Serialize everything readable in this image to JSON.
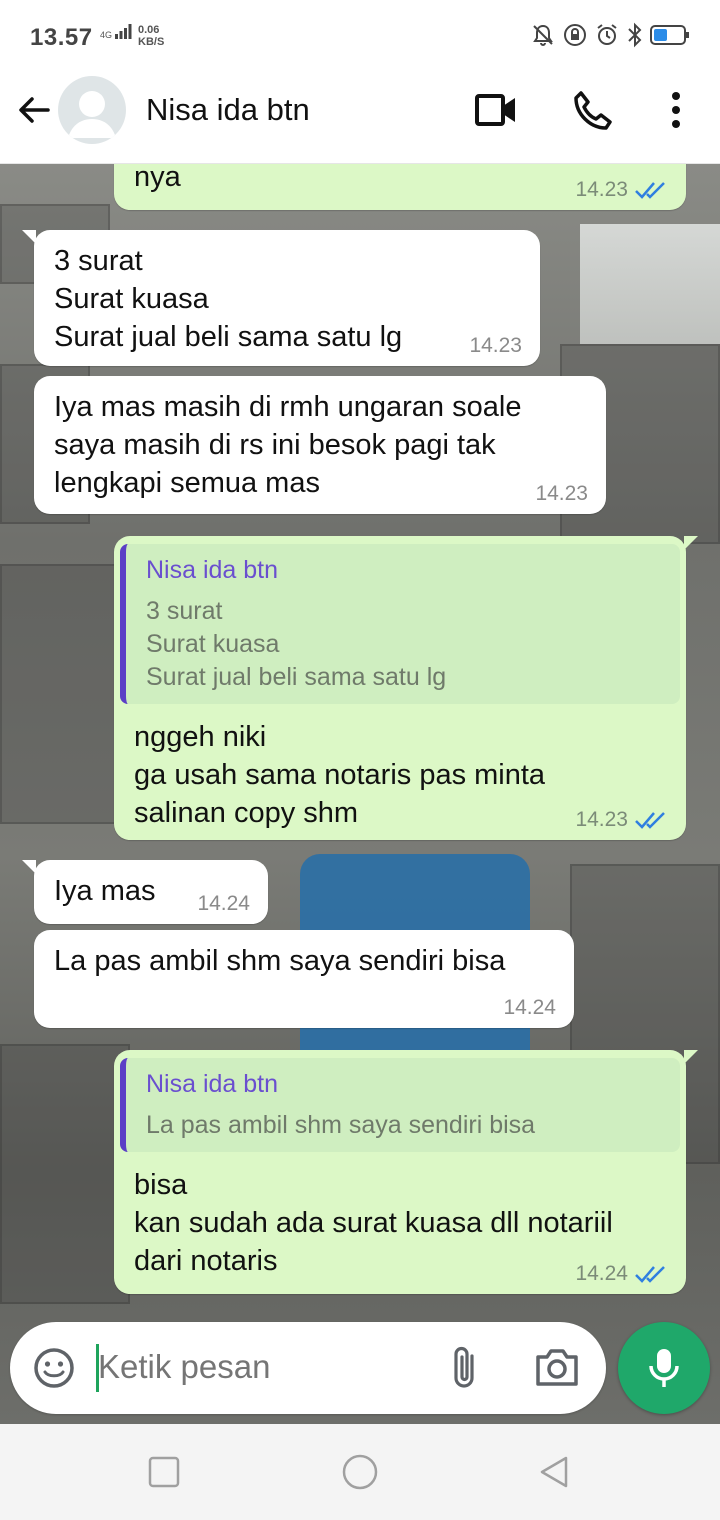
{
  "status_bar": {
    "time": "13.57",
    "network": "4G",
    "speed_value": "0.06",
    "speed_unit": "KB/S",
    "icons": [
      "bell-off-icon",
      "lock-rotation-icon",
      "alarm-icon",
      "bluetooth-icon",
      "battery-icon"
    ],
    "battery_color": "#2b8ce8"
  },
  "header": {
    "contact_name": "Nisa ida btn",
    "icons": [
      "back-arrow-icon",
      "avatar-icon",
      "video-call-icon",
      "phone-call-icon",
      "more-vert-icon"
    ]
  },
  "messages": [
    {
      "direction": "out",
      "text": "nya",
      "time": "14.23",
      "ticks": "read"
    },
    {
      "direction": "in",
      "text": "3 surat\nSurat kuasa\nSurat jual beli sama satu lg",
      "time": "14.23"
    },
    {
      "direction": "in",
      "text": "Iya mas masih di rmh ungaran soale\nsaya masih di rs ini besok pagi tak\nlengkapi semua mas",
      "time": "14.23"
    },
    {
      "direction": "out",
      "quote": {
        "name": "Nisa ida btn",
        "text": "3 surat\nSurat kuasa\nSurat jual beli sama satu lg"
      },
      "text": "nggeh niki\nga usah sama notaris pas minta\nsalinan copy shm",
      "time": "14.23",
      "ticks": "read"
    },
    {
      "direction": "in",
      "text": "Iya mas",
      "time": "14.24"
    },
    {
      "direction": "in",
      "text": "La pas ambil shm saya sendiri bisa",
      "time": "14.24"
    },
    {
      "direction": "out",
      "quote": {
        "name": "Nisa ida btn",
        "text": "La pas ambil shm saya sendiri bisa"
      },
      "text": "bisa\nkan sudah ada surat kuasa dll notariil\ndari notaris",
      "time": "14.24",
      "ticks": "read"
    }
  ],
  "input": {
    "placeholder": "Ketik pesan",
    "icons": [
      "emoji-icon",
      "attach-icon",
      "camera-icon",
      "mic-icon"
    ]
  },
  "colors": {
    "outgoing_bubble": "#dcf8c6",
    "incoming_bubble": "#ffffff",
    "read_tick": "#2f7fe0",
    "quote_bar": "#5b3fc6",
    "mic_button": "#1fa86a"
  },
  "nav": {
    "icons": [
      "recent-apps-icon",
      "home-icon",
      "back-icon"
    ]
  }
}
